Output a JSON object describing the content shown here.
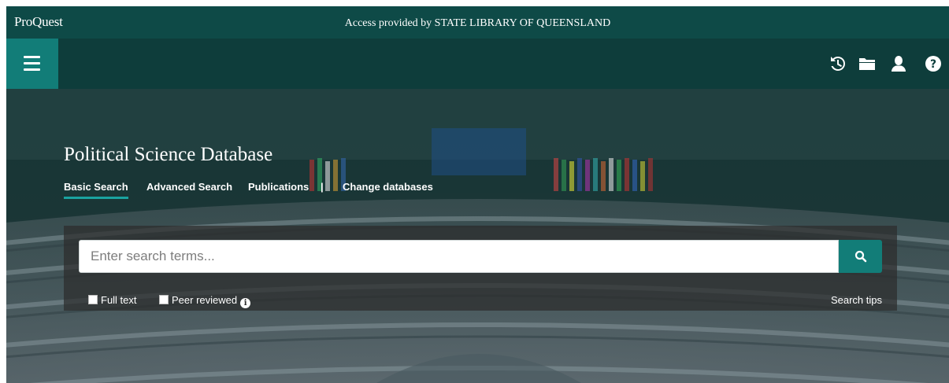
{
  "topbar": {
    "brand": "ProQuest",
    "access_text": "Access provided by STATE LIBRARY OF QUEENSLAND"
  },
  "header": {
    "menu_icon": "hamburger-menu-icon",
    "icons": [
      "history-icon",
      "folder-icon",
      "user-icon",
      "help-icon"
    ]
  },
  "hero": {
    "database_title": "Political Science Database",
    "tabs": [
      {
        "label": "Basic Search",
        "active": true
      },
      {
        "label": "Advanced Search",
        "active": false
      },
      {
        "label": "Publications",
        "active": false
      },
      {
        "label": "Change databases",
        "active": false
      }
    ],
    "separator": "|"
  },
  "search": {
    "placeholder": "Enter search terms...",
    "value": "",
    "button_icon": "search-icon",
    "options": [
      {
        "label": "Full text",
        "checked": false
      },
      {
        "label": "Peer reviewed",
        "checked": false
      }
    ],
    "info_icon": "info-icon",
    "tips_label": "Search tips"
  },
  "colors": {
    "topbar": "#0e4a47",
    "accent": "#127d78",
    "tab_underline": "#1aa3a0"
  }
}
